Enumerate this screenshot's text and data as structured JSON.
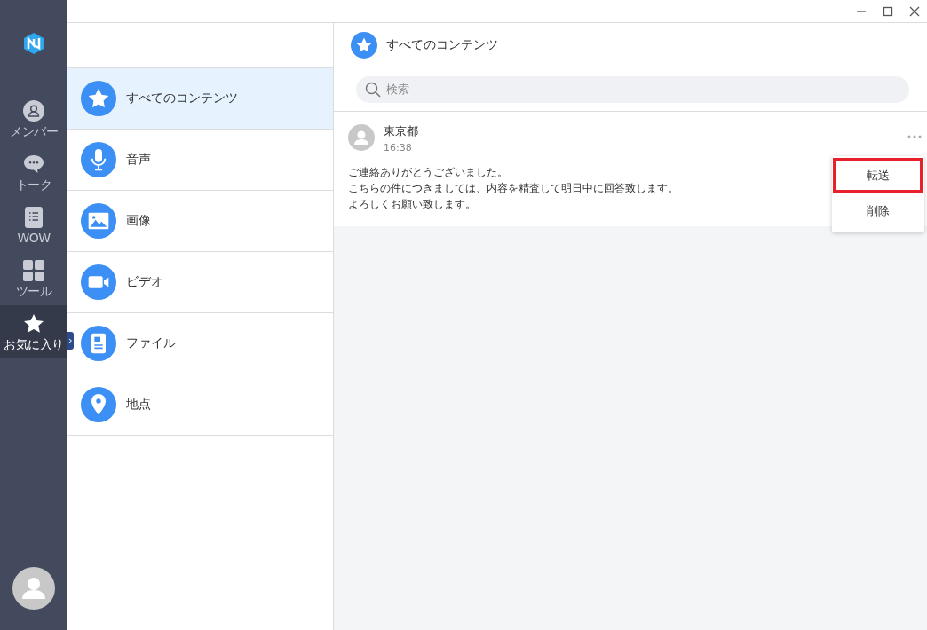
{
  "sidebar": {
    "items": [
      {
        "label": "メンバー",
        "selected": false
      },
      {
        "label": "トーク",
        "selected": false
      },
      {
        "label": "WOW",
        "selected": false
      },
      {
        "label": "ツール",
        "selected": false
      },
      {
        "label": "お気に入り",
        "selected": true
      }
    ]
  },
  "categories": [
    {
      "label": "すべてのコンテンツ",
      "selected": true
    },
    {
      "label": "音声",
      "selected": false
    },
    {
      "label": "画像",
      "selected": false
    },
    {
      "label": "ビデオ",
      "selected": false
    },
    {
      "label": "ファイル",
      "selected": false
    },
    {
      "label": "地点",
      "selected": false
    }
  ],
  "content_header": {
    "title": "すべてのコンテンツ"
  },
  "search": {
    "placeholder": "検索"
  },
  "messages": [
    {
      "sender": "東京都",
      "time": "16:38",
      "lines": [
        "ご連絡ありがとうございました。",
        "こちらの件につきましては、内容を精査して明日中に回答致します。",
        "よろしくお願い致します。"
      ]
    }
  ],
  "context_menu": {
    "items": [
      {
        "label": "転送",
        "highlighted": true
      },
      {
        "label": "削除",
        "highlighted": false
      }
    ]
  }
}
